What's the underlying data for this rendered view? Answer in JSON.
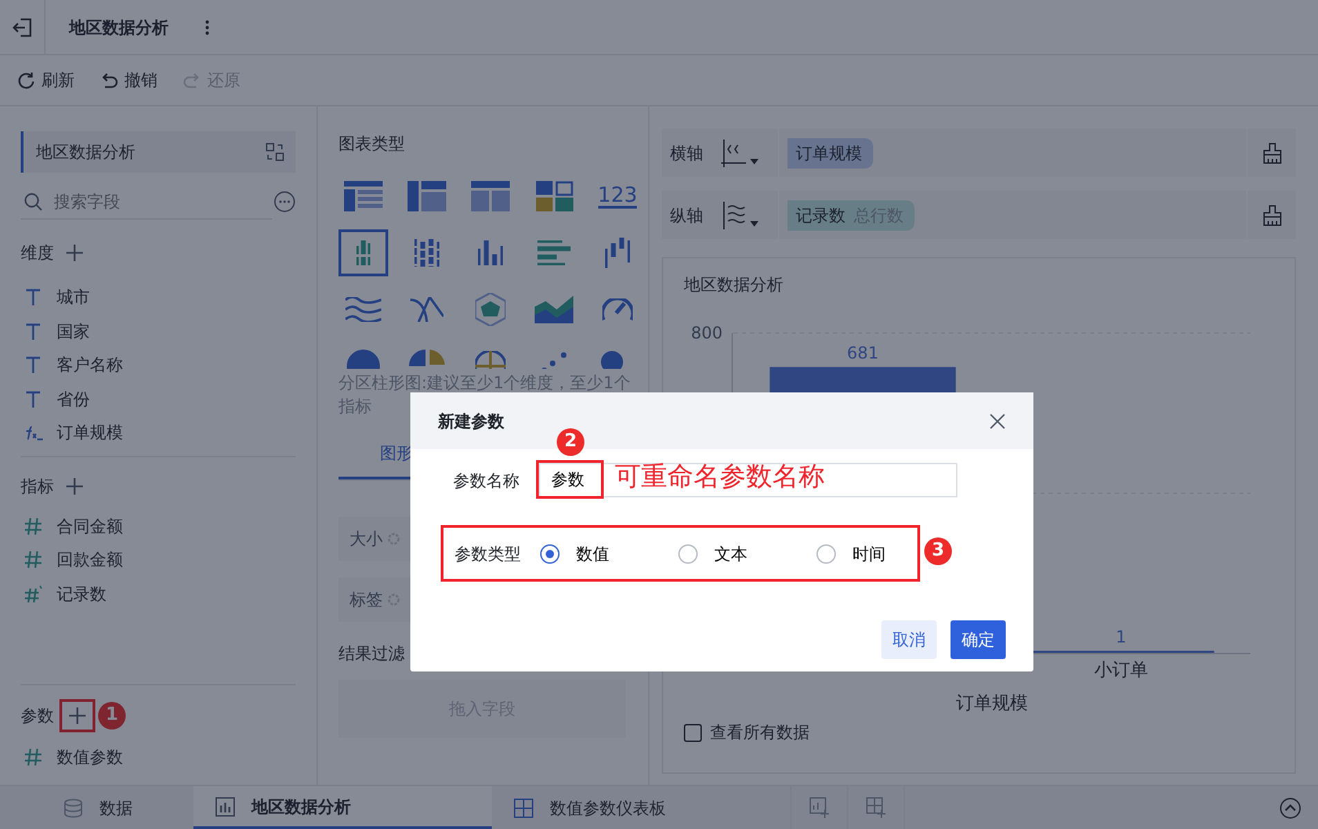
{
  "header": {
    "title": "地区数据分析"
  },
  "toolbar": [
    {
      "label": "刷新",
      "kind": "refresh",
      "disabled": false
    },
    {
      "label": "撤销",
      "kind": "undo",
      "disabled": false
    },
    {
      "label": "还原",
      "kind": "redo",
      "disabled": true
    }
  ],
  "data_panel": {
    "dataset": "地区数据分析",
    "search": {
      "placeholder": "搜索字段"
    },
    "sections": [
      {
        "title": "维度",
        "fields": [
          {
            "name": "城市",
            "kind": "text"
          },
          {
            "name": "国家",
            "kind": "text"
          },
          {
            "name": "客户名称",
            "kind": "text"
          },
          {
            "name": "省份",
            "kind": "text"
          },
          {
            "name": "订单规模",
            "kind": "formula"
          }
        ]
      },
      {
        "title": "指标",
        "fields": [
          {
            "name": "合同金额",
            "kind": "number"
          },
          {
            "name": "回款金额",
            "kind": "number"
          },
          {
            "name": "记录数",
            "kind": "count"
          }
        ]
      },
      {
        "title": "参数",
        "annotation": {
          "step": "1"
        },
        "fields": [
          {
            "name": "数值参数",
            "kind": "number"
          }
        ]
      }
    ]
  },
  "chart_panel": {
    "title": "图表类型",
    "chart_types": [
      {
        "kind": "table",
        "selected": false
      },
      {
        "kind": "crosstab",
        "selected": false
      },
      {
        "kind": "detail",
        "selected": false
      },
      {
        "kind": "blocks",
        "selected": false
      },
      {
        "kind": "number",
        "label": "123",
        "selected": false
      },
      {
        "kind": "grouped-bar",
        "selected": true
      },
      {
        "kind": "stacked-bar",
        "selected": false
      },
      {
        "kind": "bar",
        "selected": false
      },
      {
        "kind": "hbar",
        "selected": false
      },
      {
        "kind": "waterfall",
        "selected": false
      },
      {
        "kind": "line",
        "selected": false
      },
      {
        "kind": "cross-line",
        "selected": false
      },
      {
        "kind": "radar",
        "selected": false
      },
      {
        "kind": "area",
        "selected": false
      },
      {
        "kind": "gauge",
        "selected": false
      },
      {
        "kind": "pie",
        "selected": false
      },
      {
        "kind": "pie-split",
        "selected": false
      },
      {
        "kind": "globe",
        "selected": false
      },
      {
        "kind": "scatter",
        "selected": false
      },
      {
        "kind": "bubble",
        "selected": false
      }
    ],
    "hint": "分区柱形图:建议至少1个维度，至少1个指标",
    "tab": "图形",
    "settings": [
      "大小",
      "标签"
    ],
    "filter_title": "结果过滤",
    "drop_hint": "拖入字段"
  },
  "axes": [
    {
      "label": "横轴",
      "kind": "x",
      "pill": "订单规模"
    },
    {
      "label": "纵轴",
      "kind": "y",
      "pill": "记录数",
      "pill_sub": "总行数"
    }
  ],
  "chart": {
    "title": "地区数据分析",
    "y_tick": "800",
    "bars": [
      {
        "value": "681"
      },
      {
        "value": "1",
        "category": "小订单"
      }
    ],
    "x_title": "订单规模",
    "show_all": {
      "label": "查看所有数据",
      "checked": false
    }
  },
  "bottom_tabs": [
    {
      "label": "数据",
      "kind": "data",
      "selected": false
    },
    {
      "label": "地区数据分析",
      "kind": "chart",
      "selected": true
    },
    {
      "label": "数值参数仪表板",
      "kind": "dashboard",
      "selected": false
    }
  ],
  "dialog": {
    "title": "新建参数",
    "name_label": "参数名称",
    "name_value": "参数",
    "name_annotation": {
      "step": "2",
      "note": "可重命名参数名称"
    },
    "type_label": "参数类型",
    "type_annotation": {
      "step": "3"
    },
    "types": [
      {
        "label": "数值",
        "selected": true
      },
      {
        "label": "文本",
        "selected": false
      },
      {
        "label": "时间",
        "selected": false
      }
    ],
    "buttons": [
      {
        "label": "取消",
        "kind": "secondary"
      },
      {
        "label": "确定",
        "kind": "primary"
      }
    ]
  }
}
